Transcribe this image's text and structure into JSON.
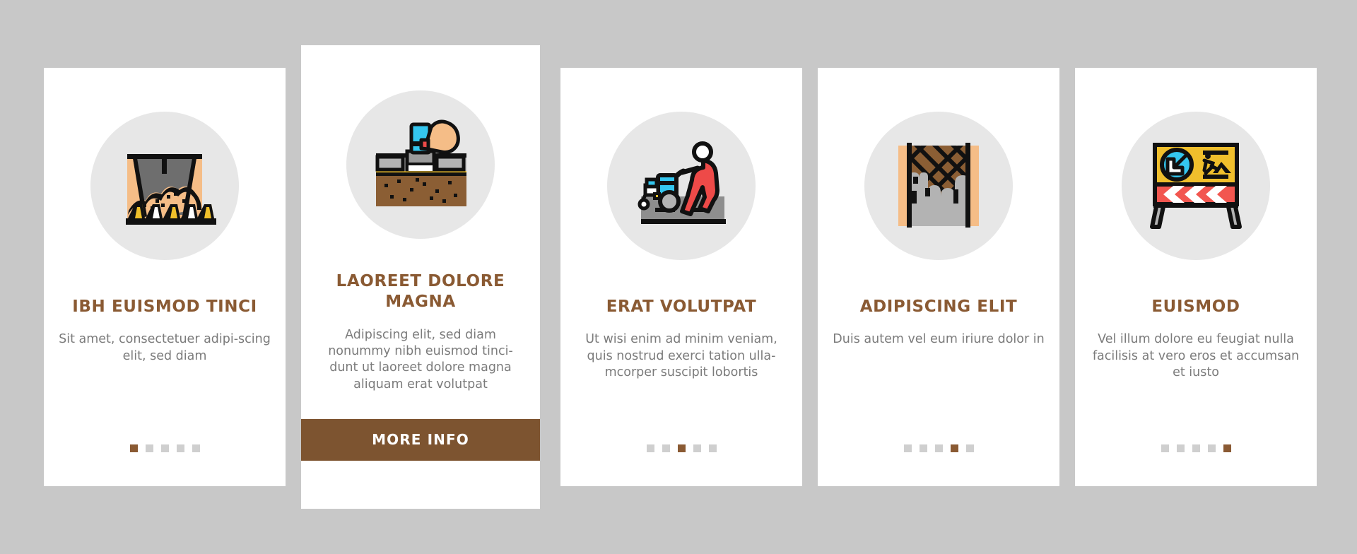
{
  "page": {
    "background_color": "#c8c8c8",
    "card_background": "#ffffff",
    "accent_color": "#8a5a33",
    "cta_color": "#7d5430",
    "body_text_color": "#7b7b7b",
    "dot_inactive_color": "#cfcfcf",
    "icon_circle_color": "#e7e7e7"
  },
  "cards": [
    {
      "id": "card-1",
      "icon_name": "excavation-pit-cones-icon",
      "title": "IBH EUISMOD TINCI",
      "body": "Sit amet, consectetuer adipi-scing elit, sed diam",
      "dots": {
        "count": 5,
        "active_index": 0
      },
      "has_cta": false,
      "cta_label": ""
    },
    {
      "id": "card-2",
      "icon_name": "hand-laying-paving-stone-icon",
      "title": "LAOREET DOLORE MAGNA",
      "body": "Adipiscing elit, sed diam nonummy nibh euismod tinci-dunt ut laoreet dolore magna aliquam erat volutpat",
      "dots": {
        "count": 5,
        "active_index": 1
      },
      "has_cta": true,
      "cta_label": "MORE INFO"
    },
    {
      "id": "card-3",
      "icon_name": "worker-road-marking-machine-icon",
      "title": "ERAT VOLUTPAT",
      "body": "Ut wisi enim ad minim veniam, quis nostrud exerci tation ulla-mcorper suscipit lobortis",
      "dots": {
        "count": 5,
        "active_index": 2
      },
      "has_cta": false,
      "cta_label": ""
    },
    {
      "id": "card-4",
      "icon_name": "mesh-reinforced-wall-icon",
      "title": "ADIPISCING ELIT",
      "body": "Duis autem vel eum iriure dolor in",
      "dots": {
        "count": 5,
        "active_index": 3
      },
      "has_cta": false,
      "cta_label": ""
    },
    {
      "id": "card-5",
      "icon_name": "roadwork-barrier-sign-icon",
      "title": "EUISMOD",
      "body": "Vel illum dolore eu feugiat nulla facilisis at vero eros et accumsan et iusto",
      "dots": {
        "count": 5,
        "active_index": 4
      },
      "has_cta": false,
      "cta_label": ""
    }
  ]
}
